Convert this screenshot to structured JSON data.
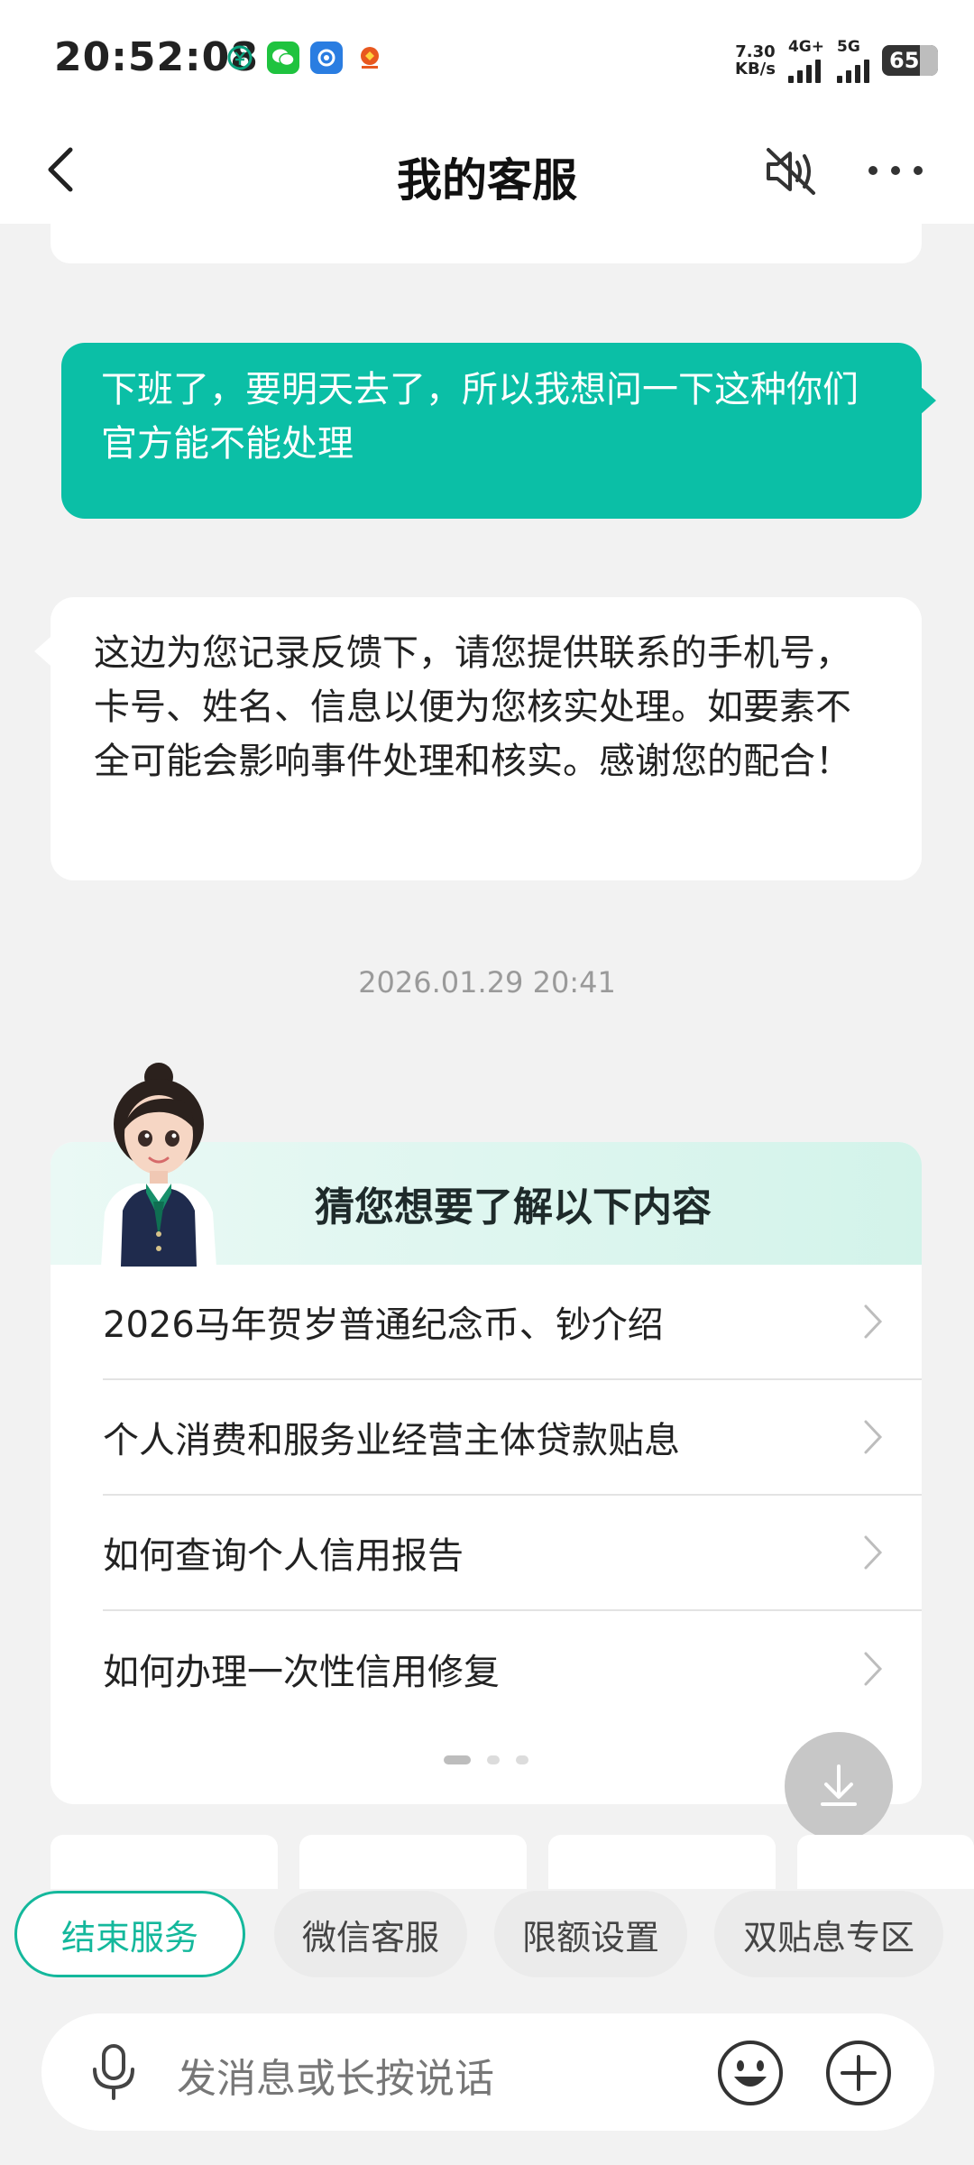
{
  "status_bar": {
    "time": "20:52:08",
    "net_speed_value": "7.30",
    "net_speed_unit": "KB/s",
    "network_1": "4G+",
    "network_2": "5G",
    "battery": "65"
  },
  "header": {
    "title": "我的客服"
  },
  "chat": {
    "user_message": "下班了，要明天去了，所以我想问一下这种你们官方能不能处理",
    "bot_message": "这边为您记录反馈下，请您提供联系的手机号，卡号、姓名、信息以便为您核实处理。如要素不全可能会影响事件处理和核实。感谢您的配合！",
    "timestamp": "2026.01.29 20:41"
  },
  "suggestions": {
    "title": "猜您想要了解以下内容",
    "items": [
      "2026马年贺岁普通纪念币、钞介绍",
      "个人消费和服务业经营主体贷款贴息",
      "如何查询个人信用报告",
      "如何办理一次性信用修复"
    ]
  },
  "quick_actions": [
    "结束服务",
    "微信客服",
    "限额设置",
    "双贴息专区"
  ],
  "input": {
    "placeholder": "发消息或长按说话"
  },
  "colors": {
    "accent": "#0bbfa6",
    "chip_primary": "#14b89c"
  }
}
